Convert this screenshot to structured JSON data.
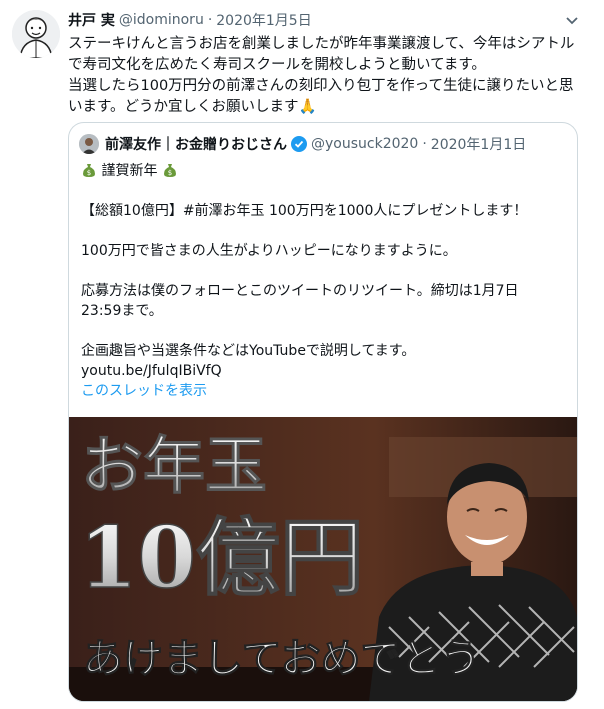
{
  "tweet": {
    "display_name": "井戸 実",
    "handle": "@idominoru",
    "date": "2020年1月5日",
    "text": "ステーキけんと言うお店を創業しましたが昨年事業譲渡して、今年はシアトルで寿司文化を広めたく寿司スクールを開校しようと動いてます。\n当選したら100万円分の前澤さんの刻印入り包丁を作って生徒に譲りたいと思います。どうか宜しくお願いします",
    "emoji": "🙏"
  },
  "quoted": {
    "display_name": "前澤友作｜お金贈りおじさん",
    "handle": "@yousuck2020",
    "date": "2020年1月1日",
    "line1": "謹賀新年",
    "line2": "【総額10億円】#前澤お年玉 100万円を1000人にプレゼントします！",
    "line3": "100万円で皆さまの人生がよりハッピーになりますように。",
    "line4a": "応募方法は僕のフォローとこのツイートのリツイート。締切は1月7日",
    "line4b": "23:59まで。",
    "line5": "企画趣旨や当選条件などはYouTubeで説明してます。",
    "link": "youtu.be/JfulqIBiVfQ",
    "show_thread": "このスレッドを表示"
  },
  "image": {
    "line1": "お年玉",
    "line2": "10億円",
    "line3": "あけましておめでとう"
  },
  "colors": {
    "link": "#1d9bf0",
    "muted": "#536471",
    "border": "#cfd9de"
  }
}
